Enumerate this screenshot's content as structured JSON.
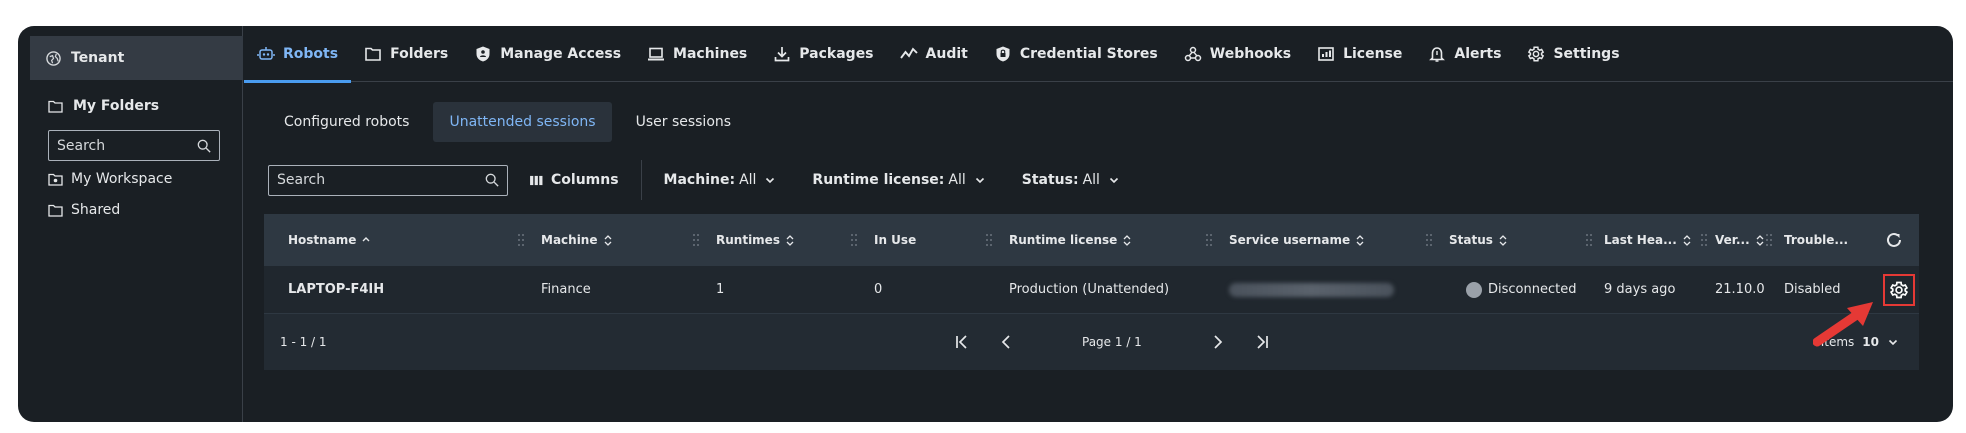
{
  "sidebar": {
    "tenant": "Tenant",
    "my_folders": "My Folders",
    "search_placeholder": "Search",
    "items": [
      {
        "label": "My Workspace",
        "icon": "workspace-folder-icon"
      },
      {
        "label": "Shared",
        "icon": "folder-icon"
      }
    ]
  },
  "nav": {
    "tabs": [
      {
        "label": "Robots",
        "icon": "robot-icon",
        "active": true
      },
      {
        "label": "Folders",
        "icon": "folder-icon"
      },
      {
        "label": "Manage Access",
        "icon": "shield-icon"
      },
      {
        "label": "Machines",
        "icon": "laptop-icon"
      },
      {
        "label": "Packages",
        "icon": "download-icon"
      },
      {
        "label": "Audit",
        "icon": "activity-icon"
      },
      {
        "label": "Credential Stores",
        "icon": "shield-lock-icon"
      },
      {
        "label": "Webhooks",
        "icon": "webhook-icon"
      },
      {
        "label": "License",
        "icon": "license-icon"
      },
      {
        "label": "Alerts",
        "icon": "bell-icon"
      },
      {
        "label": "Settings",
        "icon": "gear-icon"
      }
    ]
  },
  "subtabs": [
    {
      "label": "Configured robots"
    },
    {
      "label": "Unattended sessions",
      "active": true
    },
    {
      "label": "User sessions"
    }
  ],
  "toolbar": {
    "search_placeholder": "Search",
    "columns_label": "Columns",
    "filters": [
      {
        "name": "Machine:",
        "value": "All"
      },
      {
        "name": "Runtime license:",
        "value": "All"
      },
      {
        "name": "Status:",
        "value": "All"
      }
    ]
  },
  "table": {
    "headers": {
      "hostname": "Hostname",
      "machine": "Machine",
      "runtimes": "Runtimes",
      "in_use": "In Use",
      "runtime_license": "Runtime license",
      "service_username": "Service username",
      "status": "Status",
      "last_heartbeat": "Last Hea...",
      "version": "Ver...",
      "troubleshooting": "Trouble..."
    },
    "row": {
      "hostname": "LAPTOP-F4IH",
      "machine": "Finance",
      "runtimes": "1",
      "in_use": "0",
      "runtime_license": "Production (Unattended)",
      "status": "Disconnected",
      "last_heartbeat": "9 days ago",
      "version": "21.10.0",
      "troubleshooting": "Disabled"
    }
  },
  "pager": {
    "range": "1 - 1 / 1",
    "page": "Page 1 / 1",
    "items_label": "Items",
    "items_value": "10"
  },
  "colors": {
    "background": "#1a1f24",
    "accent": "#7fb6f5",
    "highlight": "#e53935"
  }
}
